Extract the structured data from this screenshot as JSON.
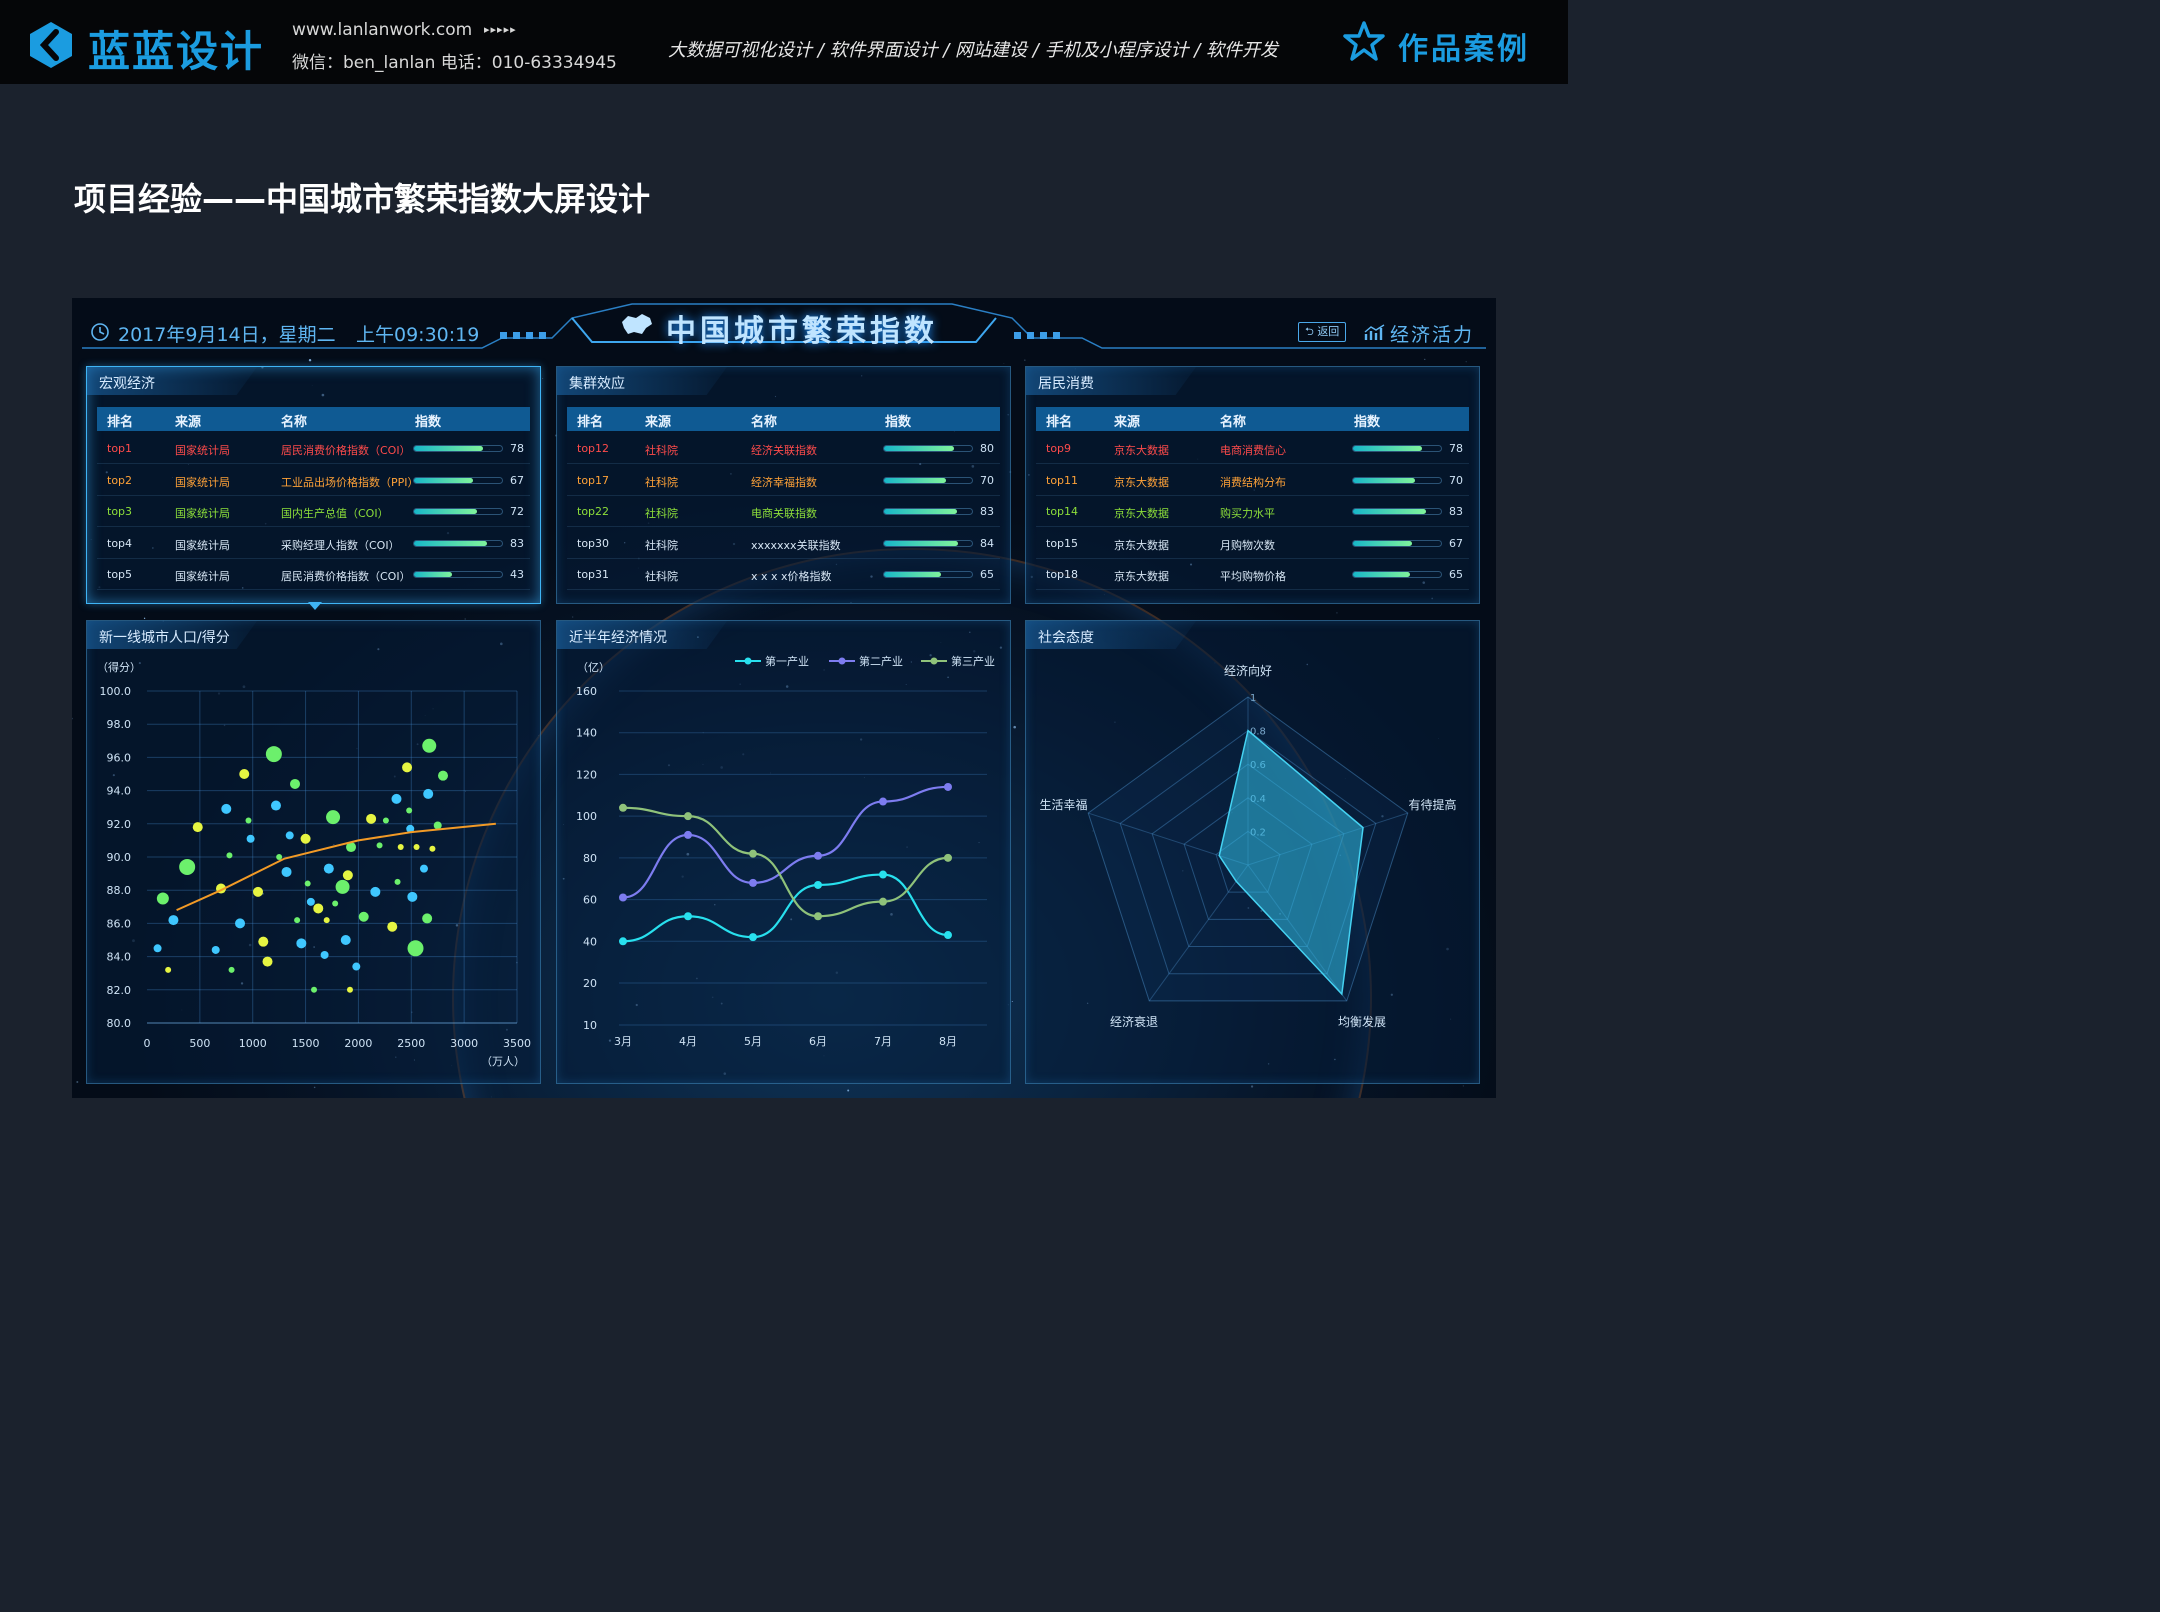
{
  "topbar": {
    "brand": "蓝蓝设计",
    "url": "www.lanlanwork.com",
    "arrows": "▸▸▸▸▸",
    "contact": "微信：ben_lanlan    电话：010-63334945",
    "services": "大数据可视化设计  /  软件界面设计  /  网站建设  /  手机及小程序设计  /  软件开发",
    "portfolio": "作品案例"
  },
  "page_heading": "项目经验——中国城市繁荣指数大屏设计",
  "dashboard": {
    "date": "2017年9月14日，星期二",
    "time": "上午09:30:19",
    "title": "中国城市繁荣指数",
    "back_label": "返回",
    "vitality_label": "经济活力"
  },
  "table_headers": [
    "排名",
    "来源",
    "名称",
    "指数"
  ],
  "panels": {
    "macro": {
      "title": "宏观经济",
      "rows": [
        {
          "rank": "top1",
          "source": "国家统计局",
          "name": "居民消费价格指数（COI）",
          "value": 78,
          "color": "#ff4b4b"
        },
        {
          "rank": "top2",
          "source": "国家统计局",
          "name": "工业品出场价格指数（PPI）",
          "value": 67,
          "color": "#ffa238"
        },
        {
          "rank": "top3",
          "source": "国家统计局",
          "name": "国内生产总值（COI）",
          "value": 72,
          "color": "#8ddf3a"
        },
        {
          "rank": "top4",
          "source": "国家统计局",
          "name": "采购经理人指数（COI）",
          "value": 83,
          "color": "#d7e6f4"
        },
        {
          "rank": "top5",
          "source": "国家统计局",
          "name": "居民消费价格指数（COI）",
          "value": 43,
          "color": "#d7e6f4"
        }
      ]
    },
    "cluster": {
      "title": "集群效应",
      "rows": [
        {
          "rank": "top12",
          "source": "社科院",
          "name": "经济关联指数",
          "value": 80,
          "color": "#ff4b4b"
        },
        {
          "rank": "top17",
          "source": "社科院",
          "name": "经济幸福指数",
          "value": 70,
          "color": "#ffa238"
        },
        {
          "rank": "top22",
          "source": "社科院",
          "name": "电商关联指数",
          "value": 83,
          "color": "#8ddf3a"
        },
        {
          "rank": "top30",
          "source": "社科院",
          "name": "xxxxxxx关联指数",
          "value": 84,
          "color": "#d7e6f4"
        },
        {
          "rank": "top31",
          "source": "社科院",
          "name": "x x x x价格指数",
          "value": 65,
          "color": "#d7e6f4"
        }
      ]
    },
    "consumer": {
      "title": "居民消费",
      "rows": [
        {
          "rank": "top9",
          "source": "京东大数据",
          "name": "电商消费信心",
          "value": 78,
          "color": "#ff4b4b"
        },
        {
          "rank": "top11",
          "source": "京东大数据",
          "name": "消费结构分布",
          "value": 70,
          "color": "#ffa238"
        },
        {
          "rank": "top14",
          "source": "京东大数据",
          "name": "购买力水平",
          "value": 83,
          "color": "#8ddf3a"
        },
        {
          "rank": "top15",
          "source": "京东大数据",
          "name": "月购物次数",
          "value": 67,
          "color": "#d7e6f4"
        },
        {
          "rank": "top18",
          "source": "京东大数据",
          "name": "平均购物价格",
          "value": 65,
          "color": "#d7e6f4"
        }
      ]
    },
    "scatter_title": "新一线城市人口/得分",
    "line_title": "近半年经济情况",
    "radar_title": "社会态度"
  },
  "chart_data": [
    {
      "type": "scatter",
      "ylabel": "（得分）",
      "xlabel": "（万人）",
      "xlim": [
        0,
        3500
      ],
      "ylim": [
        80,
        100
      ],
      "xticks": [
        "0",
        "500",
        "1000",
        "1500",
        "2000",
        "2500",
        "3000",
        "3500"
      ],
      "yticks": [
        "80.0",
        "82.0",
        "84.0",
        "86.0",
        "88.0",
        "90.0",
        "92.0",
        "94.0",
        "96.0",
        "98.0",
        "100.0"
      ],
      "trend": [
        [
          280,
          86.8
        ],
        [
          700,
          88.0
        ],
        [
          1300,
          89.9
        ],
        [
          2000,
          91.0
        ],
        [
          2500,
          91.5
        ],
        [
          3300,
          92.0
        ]
      ],
      "points": [
        [
          100,
          84.5,
          4,
          "#3fc7ff"
        ],
        [
          200,
          83.2,
          3,
          "#e6f542"
        ],
        [
          150,
          87.5,
          6,
          "#6cf06c"
        ],
        [
          250,
          86.2,
          5,
          "#3fc7ff"
        ],
        [
          380,
          89.4,
          8,
          "#6cf06c"
        ],
        [
          480,
          91.8,
          5,
          "#e6f542"
        ],
        [
          700,
          88.1,
          5,
          "#e6f542"
        ],
        [
          650,
          84.4,
          4,
          "#3fc7ff"
        ],
        [
          750,
          92.9,
          5,
          "#3fc7ff"
        ],
        [
          780,
          90.1,
          3,
          "#6cf06c"
        ],
        [
          800,
          83.2,
          3,
          "#6cf06c"
        ],
        [
          880,
          86.0,
          5,
          "#3fc7ff"
        ],
        [
          920,
          95.0,
          5,
          "#e6f542"
        ],
        [
          960,
          92.2,
          3,
          "#6cf06c"
        ],
        [
          980,
          91.1,
          4,
          "#3fc7ff"
        ],
        [
          1050,
          87.9,
          5,
          "#e6f542"
        ],
        [
          1100,
          84.9,
          5,
          "#e6f542"
        ],
        [
          1140,
          83.7,
          5,
          "#e6f542"
        ],
        [
          1200,
          96.2,
          8,
          "#6cf06c"
        ],
        [
          1220,
          93.1,
          5,
          "#3fc7ff"
        ],
        [
          1250,
          90.0,
          3,
          "#6cf06c"
        ],
        [
          1320,
          89.1,
          5,
          "#3fc7ff"
        ],
        [
          1350,
          91.3,
          4,
          "#3fc7ff"
        ],
        [
          1400,
          94.4,
          5,
          "#6cf06c"
        ],
        [
          1420,
          86.2,
          3,
          "#6cf06c"
        ],
        [
          1460,
          84.8,
          5,
          "#3fc7ff"
        ],
        [
          1500,
          91.1,
          5,
          "#e6f542"
        ],
        [
          1520,
          88.4,
          3,
          "#6cf06c"
        ],
        [
          1550,
          87.3,
          4,
          "#3fc7ff"
        ],
        [
          1580,
          82.0,
          3,
          "#6cf06c"
        ],
        [
          1620,
          86.9,
          5,
          "#e6f542"
        ],
        [
          1680,
          84.1,
          4,
          "#3fc7ff"
        ],
        [
          1700,
          86.2,
          3,
          "#e6f542"
        ],
        [
          1720,
          89.3,
          5,
          "#3fc7ff"
        ],
        [
          1760,
          92.4,
          7,
          "#6cf06c"
        ],
        [
          1780,
          87.2,
          3,
          "#6cf06c"
        ],
        [
          1850,
          88.2,
          7,
          "#6cf06c"
        ],
        [
          1880,
          85.0,
          5,
          "#3fc7ff"
        ],
        [
          1900,
          88.9,
          5,
          "#e6f542"
        ],
        [
          1920,
          82.0,
          3,
          "#e6f542"
        ],
        [
          1930,
          90.6,
          5,
          "#6cf06c"
        ],
        [
          1980,
          83.4,
          4,
          "#3fc7ff"
        ],
        [
          2050,
          86.4,
          5,
          "#6cf06c"
        ],
        [
          2120,
          92.3,
          5,
          "#e6f542"
        ],
        [
          2160,
          87.9,
          5,
          "#3fc7ff"
        ],
        [
          2200,
          90.7,
          3,
          "#6cf06c"
        ],
        [
          2260,
          92.2,
          3,
          "#6cf06c"
        ],
        [
          2320,
          85.8,
          5,
          "#e6f542"
        ],
        [
          2360,
          93.5,
          5,
          "#3fc7ff"
        ],
        [
          2370,
          88.5,
          3,
          "#6cf06c"
        ],
        [
          2400,
          90.6,
          3,
          "#e6f542"
        ],
        [
          2460,
          95.4,
          5,
          "#e6f542"
        ],
        [
          2480,
          92.8,
          3,
          "#6cf06c"
        ],
        [
          2490,
          91.7,
          4,
          "#3fc7ff"
        ],
        [
          2510,
          87.6,
          5,
          "#3fc7ff"
        ],
        [
          2550,
          90.6,
          3,
          "#e6f542"
        ],
        [
          2620,
          89.3,
          4,
          "#3fc7ff"
        ],
        [
          2650,
          86.3,
          5,
          "#6cf06c"
        ],
        [
          2660,
          93.8,
          5,
          "#3fc7ff"
        ],
        [
          2670,
          96.7,
          7,
          "#6cf06c"
        ],
        [
          2700,
          90.5,
          3,
          "#e6f542"
        ],
        [
          2750,
          91.9,
          4,
          "#6cf06c"
        ],
        [
          2800,
          94.9,
          5,
          "#6cf06c"
        ],
        [
          2540,
          84.5,
          8,
          "#6cf06c"
        ]
      ]
    },
    {
      "type": "line",
      "ylabel": "（亿）",
      "x": [
        "3月",
        "4月",
        "5月",
        "6月",
        "7月",
        "8月"
      ],
      "yticks": [
        "10",
        "20",
        "40",
        "60",
        "80",
        "100",
        "120",
        "140",
        "160"
      ],
      "ylim": [
        0,
        160
      ],
      "series": [
        {
          "name": "第一产业",
          "color": "#28e0ee",
          "values": [
            40,
            52,
            42,
            67,
            72,
            43
          ]
        },
        {
          "name": "第二产业",
          "color": "#7d7cf0",
          "values": [
            61,
            91,
            68,
            81,
            107,
            114
          ]
        },
        {
          "name": "第三产业",
          "color": "#8fc27a",
          "values": [
            104,
            100,
            82,
            52,
            59,
            80
          ]
        }
      ]
    },
    {
      "type": "radar",
      "axes": [
        "经济向好",
        "有待提高",
        "均衡发展",
        "经济衰退",
        "生活幸福"
      ],
      "rings": [
        "0.2",
        "0.4",
        "0.6",
        "0.8",
        "1"
      ],
      "values": [
        0.8,
        0.72,
        0.95,
        0.12,
        0.18
      ]
    }
  ]
}
